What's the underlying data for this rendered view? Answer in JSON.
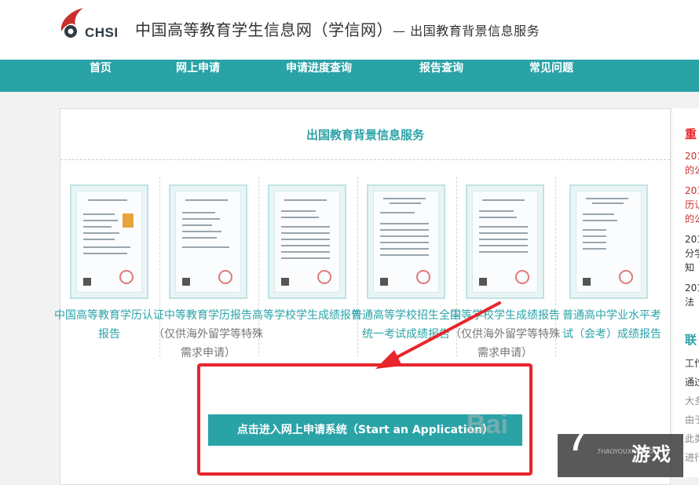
{
  "header": {
    "logo_text": "CHSI",
    "site_title": "中国高等教育学生信息网（学信网）",
    "site_subtitle": "— 出国教育背景信息服务"
  },
  "nav": {
    "items": [
      {
        "label": "首页"
      },
      {
        "label": "网上申请"
      },
      {
        "label": "申请进度查询"
      },
      {
        "label": "报告查询"
      },
      {
        "label": "常见问题"
      }
    ]
  },
  "panel": {
    "title": "出国教育背景信息服务",
    "reports": [
      {
        "name": "中国高等教育学历认证报告",
        "note": ""
      },
      {
        "name": "中等教育学历报告",
        "note": "（仅供海外留学等特殊需求申请）"
      },
      {
        "name": "高等学校学生成绩报告",
        "note": ""
      },
      {
        "name": "普通高等学校招生全国统一考试成绩报告",
        "note": ""
      },
      {
        "name": "中等学校学生成绩报告",
        "note": "（仅供海外留学等特殊需求申请）"
      },
      {
        "name": "普通高中学业水平考试（会考）成绩报告",
        "note": ""
      }
    ],
    "apply_button": "点击进入网上申请系统（Start an Application）"
  },
  "right_column": {
    "title": "重",
    "items": [
      "201",
      "的公",
      "201",
      "历认",
      "的公",
      "201",
      "分学",
      "知",
      "201",
      "法"
    ],
    "second_title": "联",
    "second_items": [
      "工作",
      "通过",
      "大多",
      "由于",
      "此类",
      "进行"
    ]
  },
  "watermark": {
    "text1": "Bai",
    "text2": "游戏",
    "sub": "7HAOYOUXIWANG"
  },
  "colors": {
    "accent": "#2aa3a7",
    "highlight": "#e8252b"
  }
}
